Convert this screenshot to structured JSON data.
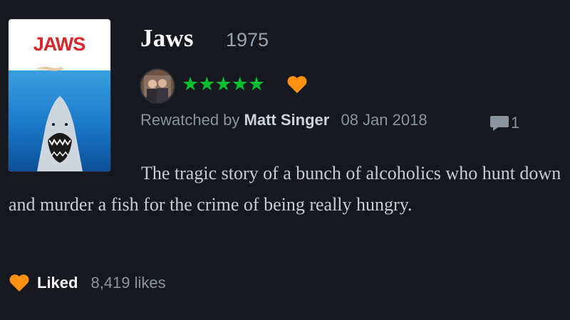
{
  "film": {
    "title": "Jaws",
    "year": "1975",
    "poster_title": "JAWS"
  },
  "review": {
    "rating_stars": "★★★★★",
    "rating": 5,
    "liked": true,
    "prefix": "Rewatched by",
    "author": "Matt Singer",
    "date": "08 Jan 2018",
    "comment_count": "1",
    "body": "The tragic story of a bunch of alcoholics who hunt down and murder a fish for the crime of being really hungry."
  },
  "footer": {
    "liked_label": "Liked",
    "likes": "8,419 likes"
  },
  "colors": {
    "background": "#15181f",
    "stars": "#00c030",
    "heart": "#ff9010",
    "title": "#ffffff",
    "muted": "#8b949e"
  },
  "icons": {
    "heart": "heart-icon",
    "comment": "comment-bubble-icon",
    "avatar": "user-avatar"
  }
}
